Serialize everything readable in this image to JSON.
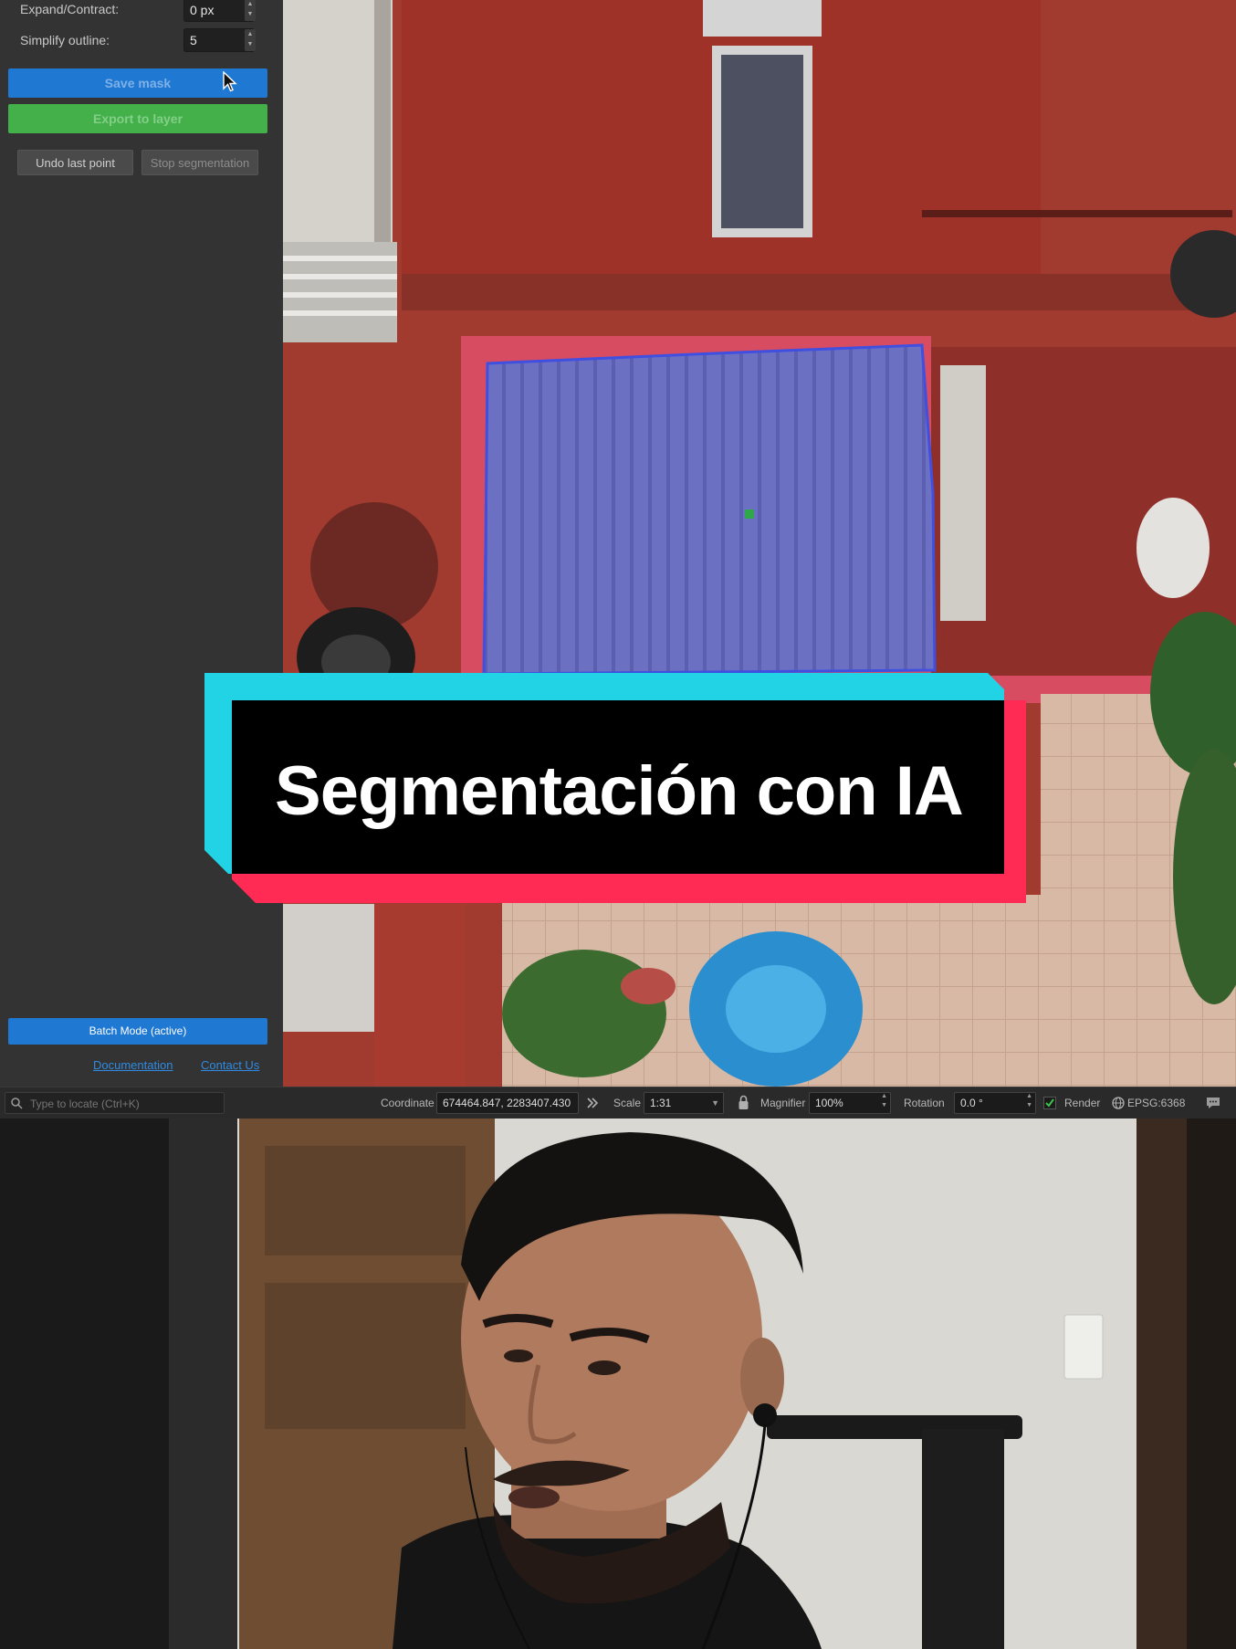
{
  "panel": {
    "expand_label": "Expand/Contract:",
    "expand_value": "0 px",
    "simplify_label": "Simplify outline:",
    "simplify_value": "5",
    "save_mask": "Save mask",
    "export_layer": "Export to layer",
    "undo_last_point": "Undo last point",
    "stop_segmentation": "Stop segmentation",
    "batch_mode": "Batch Mode (active)",
    "documentation": "Documentation",
    "contact_us": "Contact Us"
  },
  "statusbar": {
    "search_placeholder": "Type to locate (Ctrl+K)",
    "coordinate_label": "Coordinate",
    "coordinate_value": "674464.847, 2283407.430",
    "scale_label": "Scale",
    "scale_value": "1:31",
    "magnifier_label": "Magnifier",
    "magnifier_value": "100%",
    "rotation_label": "Rotation",
    "rotation_value": "0.0 °",
    "render_label": "Render",
    "crs_label": "EPSG:6368"
  },
  "overlay": {
    "title": "Segmentación con IA"
  },
  "colors": {
    "save_mask_bg": "#1f78d1",
    "export_bg": "#43b04a",
    "batch_bg": "#1f78d1",
    "card_cyan": "#22d3e6",
    "card_red": "#ff2b55",
    "mask_fill": "#6c73c9",
    "mask_outline": "#3f4fe0"
  },
  "icons": [
    "cursor-arrow-icon",
    "search-icon",
    "coordinate-toggle-icon",
    "lock-icon",
    "checkbox-checked-icon",
    "globe-icon",
    "messages-icon"
  ]
}
